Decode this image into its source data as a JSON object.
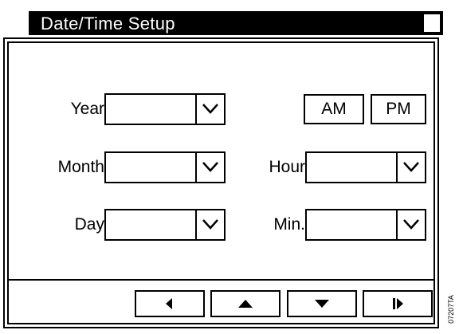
{
  "window": {
    "title": "Date/Time Setup"
  },
  "fields": {
    "year": {
      "label": "Year",
      "value": ""
    },
    "month": {
      "label": "Month",
      "value": ""
    },
    "day": {
      "label": "Day",
      "value": ""
    },
    "hour": {
      "label": "Hour",
      "value": ""
    },
    "min": {
      "label": "Min.",
      "value": ""
    }
  },
  "ampm": {
    "am_label": "AM",
    "pm_label": "PM"
  },
  "nav": {
    "buttons": [
      {
        "icon": "triangle-left-icon"
      },
      {
        "icon": "triangle-up-icon"
      },
      {
        "icon": "triangle-down-icon"
      },
      {
        "icon": "bar-triangle-right-icon"
      }
    ]
  },
  "side_tag": "07207TA"
}
